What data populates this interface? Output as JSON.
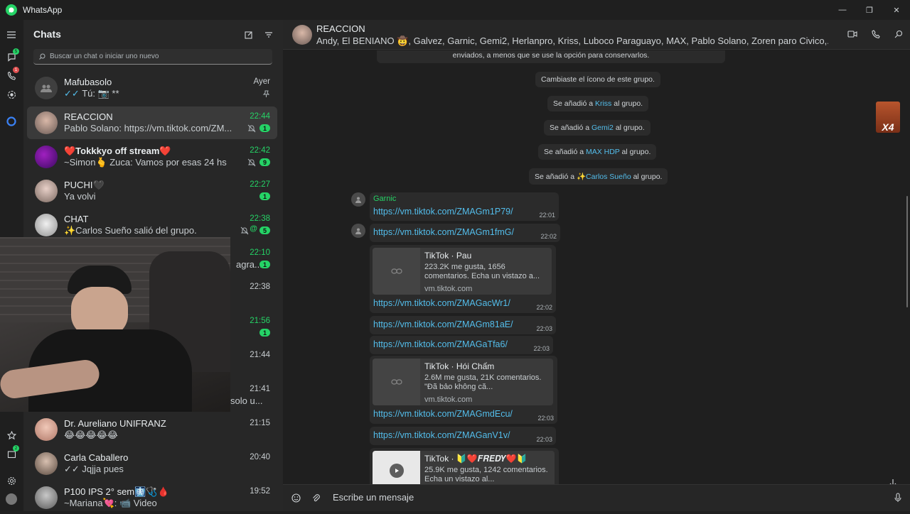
{
  "window": {
    "title": "WhatsApp"
  },
  "rail": {
    "chats_badge": "5",
    "calls_badge": "1",
    "channels_badge": "2"
  },
  "chatlist": {
    "title": "Chats",
    "search_placeholder": "Buscar un chat o iniciar uno nuevo",
    "chats": [
      {
        "name": "Mafubasolo",
        "message": "Tú: 📷 **",
        "time": "Ayer",
        "unread": "",
        "pinned": true
      },
      {
        "name": "REACCION",
        "message": "Pablo Solano: https://vm.tiktok.com/ZM...",
        "time": "22:44",
        "unread": "1"
      },
      {
        "name": "❤️Tokkkyo off stream❤️",
        "message": "~Simon🫰 Zuca: Vamos por esas 24 hs",
        "time": "22:42",
        "unread": "9"
      },
      {
        "name": "PUCHI🖤",
        "message": "Ya volvi",
        "time": "22:27",
        "unread": "1"
      },
      {
        "name": "CHAT",
        "message": "✨Carlos Sueño salió del grupo.",
        "time": "22:38",
        "unread": "5"
      },
      {
        "name": "",
        "message": "agra...",
        "time": "22:10",
        "unread": "1"
      },
      {
        "name": "",
        "message": "",
        "time": "22:38",
        "unread": ""
      },
      {
        "name": "",
        "message": "",
        "time": "21:56",
        "unread": "1"
      },
      {
        "name": "",
        "message": "",
        "time": "21:44",
        "unread": ""
      },
      {
        "name": "",
        "message": "solo u...",
        "time": "21:41",
        "unread": ""
      },
      {
        "name": "Dr. Aureliano UNIFRANZ",
        "message": "😂😂😂😂😂",
        "time": "21:15",
        "unread": ""
      },
      {
        "name": "Carla Caballero",
        "message": "✓✓ Jqjja pues",
        "time": "20:40",
        "unread": ""
      },
      {
        "name": "P100 IPS 2° sem🩻🩺🩸",
        "message": "~Mariana💘: 📹 Video",
        "time": "19:52",
        "unread": ""
      }
    ]
  },
  "conversation": {
    "name": "REACCION",
    "members": "Andy, El BENIANO 🤠, Galvez, Garnic, Gemi2, Herlanpro, Kriss, Luboco Paraguayo, MAX, Pablo Solano, Zoren paro Civico,...",
    "system_top": "enviados, a menos que se use la opción para conservarlos.",
    "system_messages": [
      {
        "pre": "Cambiaste el ícono de este grupo.",
        "name": "",
        "post": ""
      },
      {
        "pre": "Se añadió a ",
        "name": "Kriss",
        "post": " al grupo."
      },
      {
        "pre": "Se añadió a ",
        "name": "Gemi2",
        "post": " al grupo."
      },
      {
        "pre": "Se añadió a ",
        "name": "MAX HDP",
        "post": " al grupo."
      },
      {
        "pre": "Se añadió a ",
        "name": "✨Carlos Sueño",
        "post": " al grupo."
      }
    ],
    "messages": [
      {
        "sender": "Garnic",
        "link": "https://vm.tiktok.com/ZMAGm1P79/",
        "time": "22:01"
      },
      {
        "link": "https://vm.tiktok.com/ZMAGm1fmG/",
        "time": "22:02"
      },
      {
        "preview": {
          "title": "TikTok · Pau",
          "desc": "223.2K me gusta, 1656 comentarios. Echa un vistazo a...",
          "domain": "vm.tiktok.com"
        },
        "link": "https://vm.tiktok.com/ZMAGacWr1/",
        "time": "22:02"
      },
      {
        "link": "https://vm.tiktok.com/ZMAGm81aE/",
        "time": "22:03"
      },
      {
        "link": "https://vm.tiktok.com/ZMAGaTfa6/",
        "time": "22:03"
      },
      {
        "preview": {
          "title": "TikTok · Hói Chấm",
          "desc": "2.6M me gusta, 21K comentarios. \"Đã bảo không că...",
          "domain": "vm.tiktok.com"
        },
        "link": "https://vm.tiktok.com/ZMAGmdEcu/",
        "time": "22:03"
      },
      {
        "link": "https://vm.tiktok.com/ZMAGanV1v/",
        "time": "22:03"
      },
      {
        "preview": {
          "title": "TikTok · 🔰❤️𝑭𝑹𝑬𝑫𝒀❤️🔰",
          "desc": "25.9K me gusta, 1242 comentarios. Echa un vistazo al...",
          "domain": ""
        }
      }
    ],
    "sticker_text": "X4",
    "scroll_badge": "1",
    "composer_placeholder": "Escribe un mensaje"
  },
  "colors": {
    "accent": "#25d366",
    "link": "#53bdeb",
    "panel": "#272727",
    "bubble": "#2b2b2b"
  }
}
